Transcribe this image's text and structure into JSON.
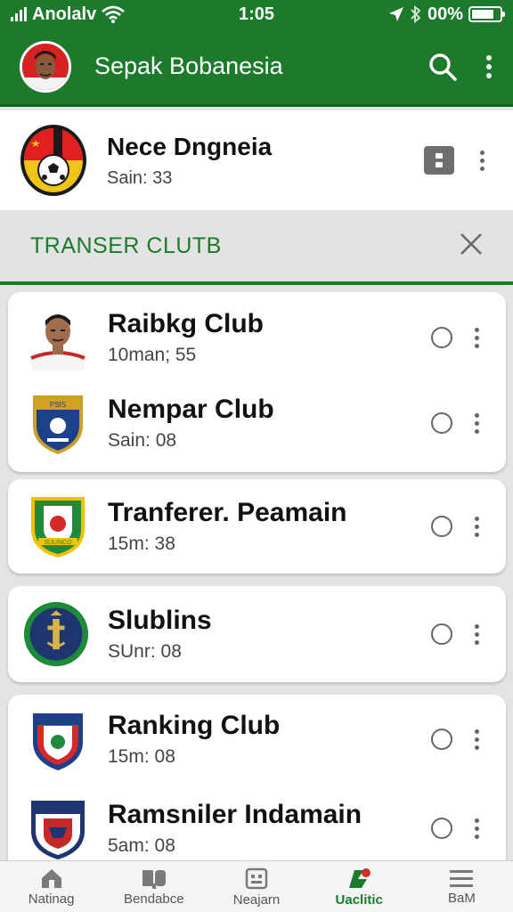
{
  "status_bar": {
    "carrier": "Anolalv",
    "time": "1:05",
    "battery": "00%",
    "battery_level": 0.8
  },
  "app_bar": {
    "title": "Sepak Bobanesia",
    "search_icon": "search-icon",
    "menu_icon": "more-vert-icon"
  },
  "selected_club": {
    "name": "Nece Dngneia",
    "subtitle": "Sain: 33"
  },
  "section": {
    "title": "TRANSER CLUTB",
    "close_icon": "close-icon"
  },
  "clubs": [
    {
      "name": "Raibkg Club",
      "subtitle": "10man; 55",
      "crest": "player-photo"
    },
    {
      "name": "Nempar Club",
      "subtitle": "Sain: 08",
      "crest": "blue-shield-crest"
    },
    {
      "name": "Tranferer. Peamain",
      "subtitle": "15m: 38",
      "crest": "green-shield-crest"
    },
    {
      "name": "Slublins",
      "subtitle": "SUnr: 08",
      "crest": "round-blue-crest"
    },
    {
      "name": "Ranking Club",
      "subtitle": "15m: 08",
      "crest": "red-blue-shield-crest"
    },
    {
      "name": "Ramsniler Indamain",
      "subtitle": "5am: 08",
      "crest": "navy-shield-crest"
    }
  ],
  "bottom_nav": [
    {
      "label": "Natinag",
      "icon": "home-icon"
    },
    {
      "label": "Bendabce",
      "icon": "book-icon"
    },
    {
      "label": "Neajarn",
      "icon": "calendar-icon"
    },
    {
      "label": "Uaclitic",
      "icon": "football-icon",
      "active": true
    },
    {
      "label": "BaM",
      "icon": "menu-icon"
    }
  ],
  "colors": {
    "primary": "#1d7a2c",
    "background": "#e4e4e4",
    "card": "#ffffff"
  }
}
